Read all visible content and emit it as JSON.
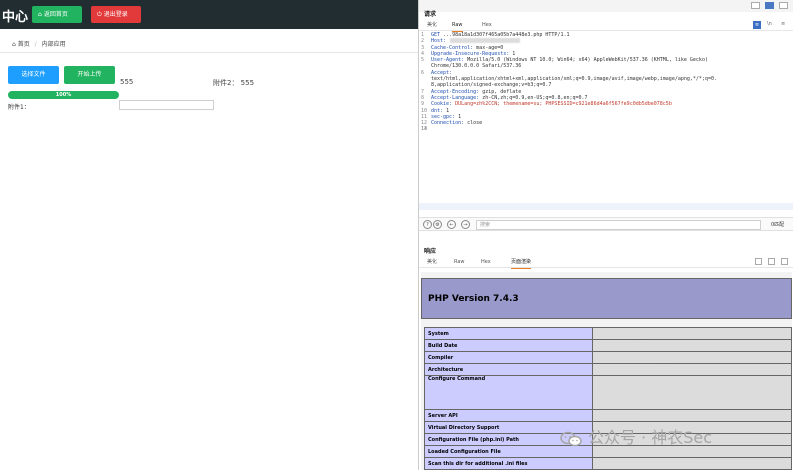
{
  "left": {
    "app_title": "中心",
    "home_button": "返回首页",
    "logout_button": "退出登录",
    "breadcrumb": [
      "首页",
      "内部应用"
    ],
    "choose_file_button": "选择文件",
    "start_upload_button": "开始上传",
    "value_a": "555",
    "attachment2_label": "附件2： 555",
    "progress": {
      "label": "100%",
      "percent": 100
    },
    "attachment1_label": "附件1："
  },
  "request": {
    "title": "请求",
    "tabs": [
      "美化",
      "Raw",
      "Hex"
    ],
    "active_tab": "Raw",
    "lines": [
      {
        "n": "1",
        "key": "GET",
        "val": "...98a18a1d307f465a05b7a448e3.php HTTP/1.1"
      },
      {
        "n": "2",
        "key": "Host:",
        "val": ""
      },
      {
        "n": "3",
        "key": "Cache-Control:",
        "val": "max-age=0"
      },
      {
        "n": "4",
        "key": "Upgrade-Insecure-Requests:",
        "val": "1"
      },
      {
        "n": "5",
        "key": "User-Agent:",
        "val": "Mozilla/5.0 (Windows NT 10.0; Win64; x64) AppleWebKit/537.36 (KHTML, like Gecko)"
      },
      {
        "n": "",
        "key": "",
        "val": "Chrome/130.0.0.0 Safari/537.36"
      },
      {
        "n": "6",
        "key": "Accept:",
        "val": ""
      },
      {
        "n": "",
        "key": "",
        "val": "text/html,application/xhtml+xml,application/xml;q=0.9,image/avif,image/webp,image/apng,*/*;q=0."
      },
      {
        "n": "",
        "key": "",
        "val": "8,application/signed-exchange;v=b3;q=0.7"
      },
      {
        "n": "7",
        "key": "Accept-Encoding:",
        "val": "gzip, deflate"
      },
      {
        "n": "8",
        "key": "Accept-Language:",
        "val": "zh-CN,zh;q=0.9,en-US;q=0.8,en;q=0.7"
      },
      {
        "n": "9",
        "key": "Cookie:",
        "val": "DULang=zh%2CCN; themename=su; PHPSESSID=c921e86d4a6f567fe9c0db5dbe078c5b"
      },
      {
        "n": "10",
        "key": "dnt:",
        "val": "1"
      },
      {
        "n": "11",
        "key": "sec-gpc:",
        "val": "1"
      },
      {
        "n": "12",
        "key": "Connection:",
        "val": "close"
      },
      {
        "n": "13",
        "key": "",
        "val": ""
      },
      {
        "n": "14",
        "key": "",
        "val": ""
      }
    ],
    "search_placeholder": "搜索",
    "match_count": "0匹配"
  },
  "response": {
    "title": "响应",
    "tabs": [
      "美化",
      "Raw",
      "Hex",
      "页面渲染"
    ],
    "active_tab": "页面渲染",
    "php_version": "PHP Version 7.4.3",
    "table_rows": [
      "System",
      "Build Date",
      "Compiler",
      "Architecture",
      "Configure Command",
      "Server API",
      "Virtual Directory Support",
      "Configuration File (php.ini) Path",
      "Loaded Configuration File",
      "Scan this dir for additional .ini files"
    ]
  },
  "watermark": "公众号 · 神农Sec"
}
